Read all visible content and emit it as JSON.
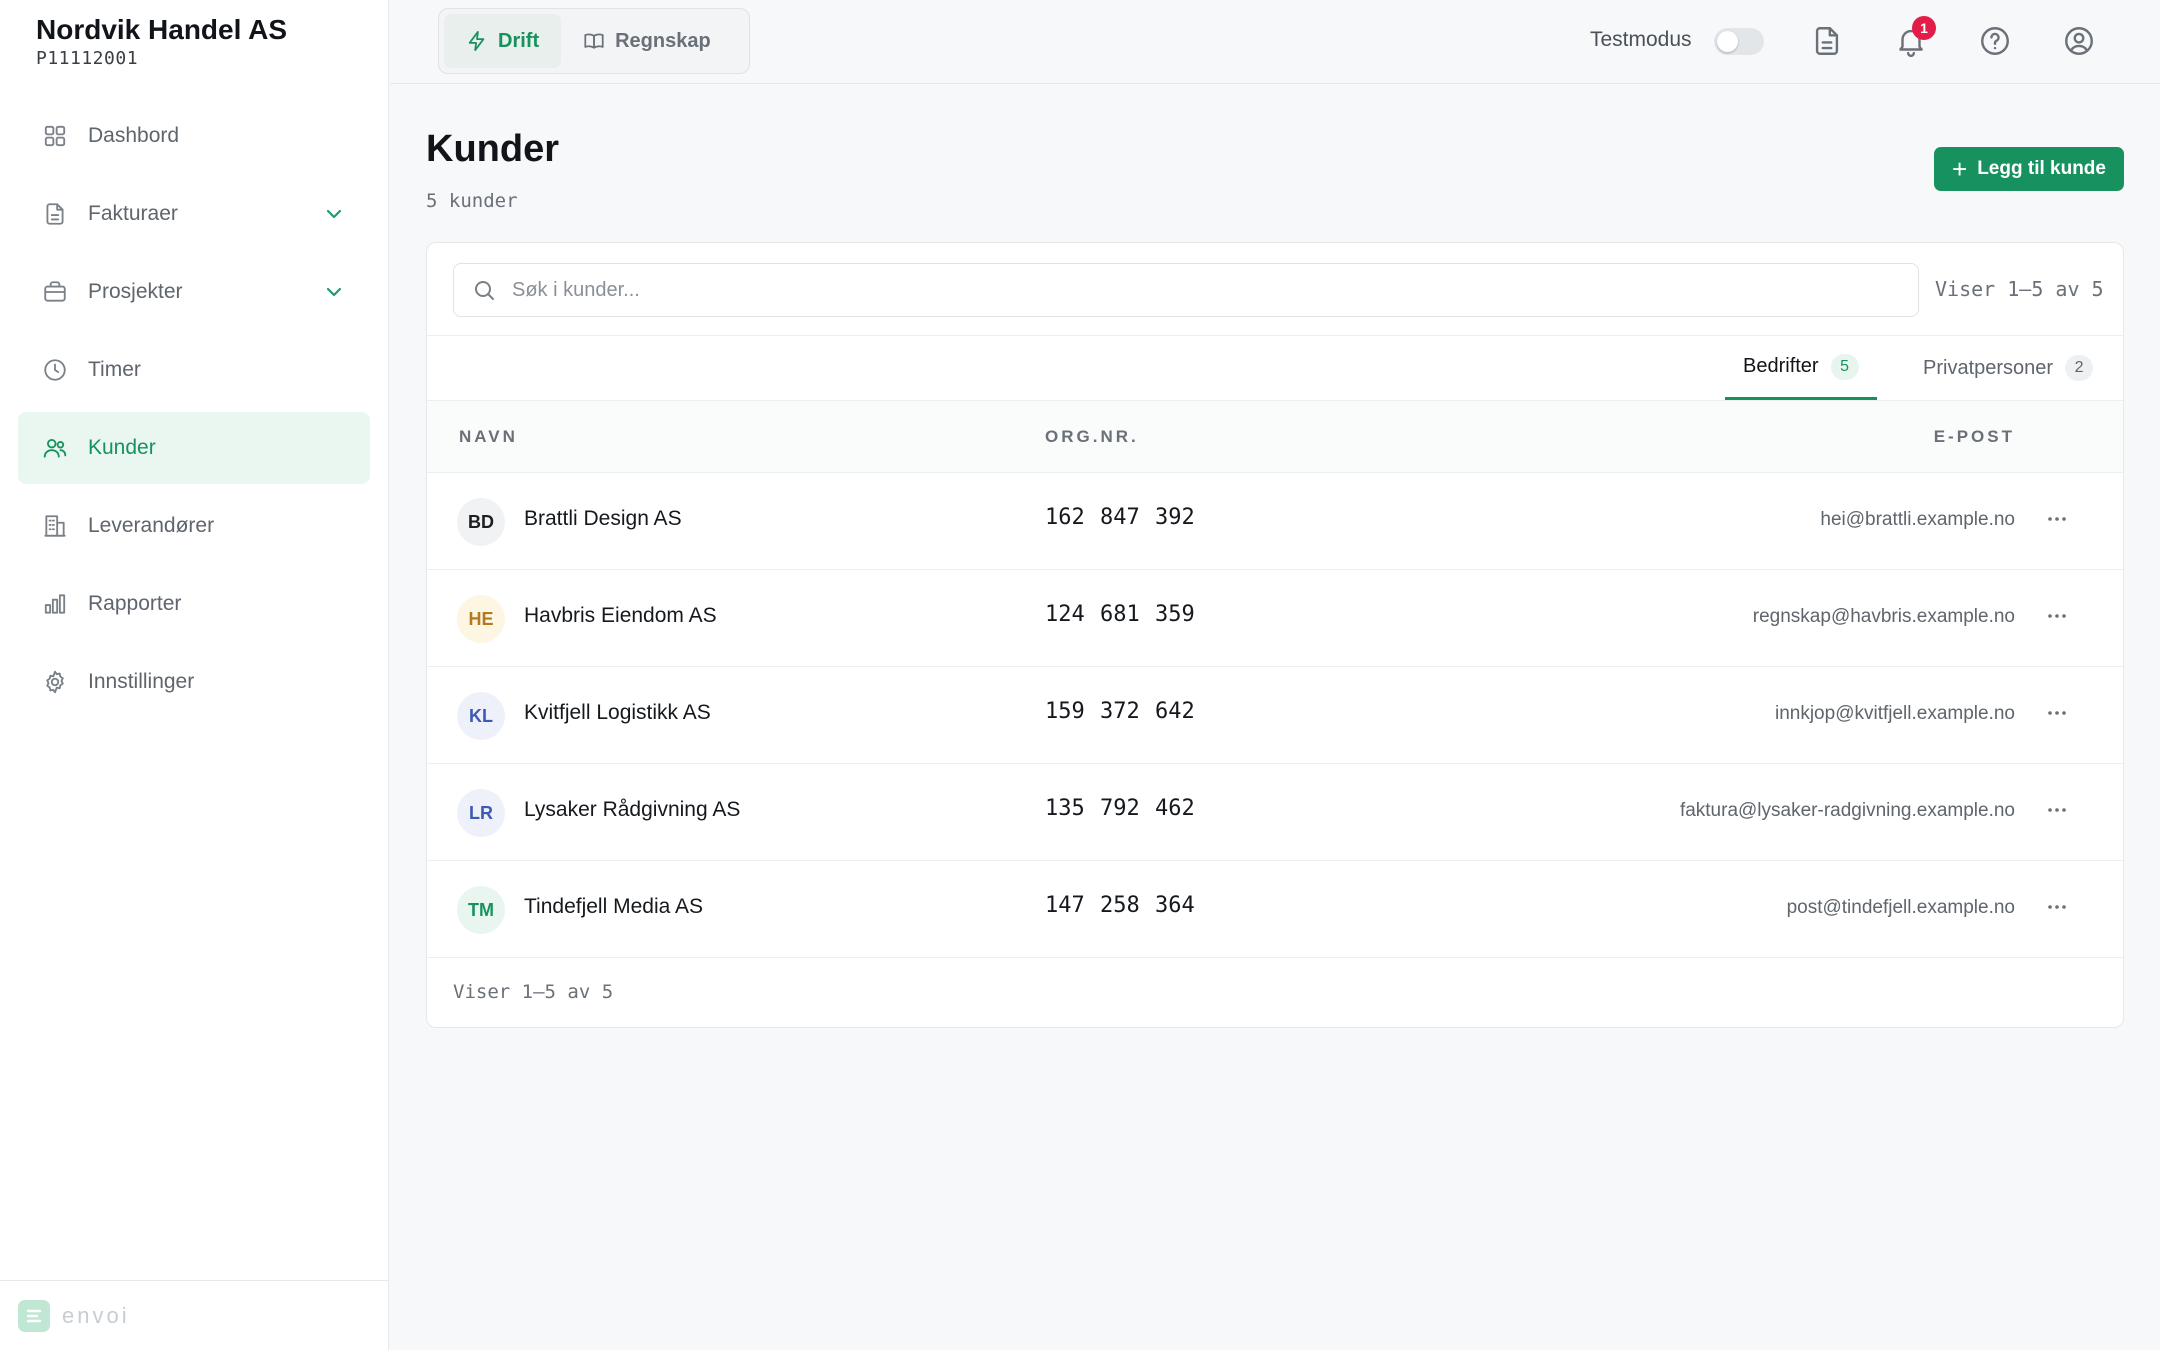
{
  "sidebar": {
    "org_name": "Nordvik Handel AS",
    "org_id": "P11112001",
    "items": [
      {
        "label": "Dashbord",
        "icon": "grid-icon"
      },
      {
        "label": "Fakturaer",
        "icon": "document-icon",
        "expandable": true
      },
      {
        "label": "Prosjekter",
        "icon": "briefcase-icon",
        "expandable": true
      },
      {
        "label": "Timer",
        "icon": "clock-icon"
      },
      {
        "label": "Kunder",
        "icon": "users-icon",
        "active": true
      },
      {
        "label": "Leverandører",
        "icon": "building-icon"
      },
      {
        "label": "Rapporter",
        "icon": "bar-chart-icon"
      },
      {
        "label": "Innstillinger",
        "icon": "gear-icon"
      }
    ],
    "brand": "envoi"
  },
  "topbar": {
    "tabs": [
      {
        "label": "Drift",
        "icon": "lightning-icon",
        "active": true
      },
      {
        "label": "Regnskap",
        "icon": "book-icon",
        "active": false
      }
    ],
    "test_mode_label": "Testmodus",
    "test_mode_on": false,
    "notification_count": "1"
  },
  "main": {
    "title": "Kunder",
    "subtitle": "5 kunder",
    "add_button_label": "Legg til kunde",
    "search_placeholder": "Søk i kunder...",
    "pagination_top": "Viser 1–5 av 5",
    "pagination_bottom": "Viser 1–5 av 5",
    "tabs": [
      {
        "label": "Bedrifter",
        "count": "5",
        "active": true
      },
      {
        "label": "Privatpersoner",
        "count": "2",
        "active": false
      }
    ],
    "columns": {
      "name": "NAVN",
      "orgnr": "ORG.NR.",
      "email": "E-POST"
    },
    "rows": [
      {
        "initials": "BD",
        "name": "Brattli Design AS",
        "orgnr": "162 847 392",
        "email": "hei@brattli.example.no",
        "avatar_bg": "#f1f2f4",
        "avatar_fg": "#1b1e23"
      },
      {
        "initials": "HE",
        "name": "Havbris Eiendom AS",
        "orgnr": "124 681 359",
        "email": "regnskap@havbris.example.no",
        "avatar_bg": "#fdf6e3",
        "avatar_fg": "#b7791f"
      },
      {
        "initials": "KL",
        "name": "Kvitfjell Logistikk AS",
        "orgnr": "159 372 642",
        "email": "innkjop@kvitfjell.example.no",
        "avatar_bg": "#eef1f9",
        "avatar_fg": "#3b5bb5"
      },
      {
        "initials": "LR",
        "name": "Lysaker Rådgivning AS",
        "orgnr": "135 792 462",
        "email": "faktura@lysaker-radgivning.example.no",
        "avatar_bg": "#eef1f9",
        "avatar_fg": "#3b5bb5"
      },
      {
        "initials": "TM",
        "name": "Tindefjell Media AS",
        "orgnr": "147 258 364",
        "email": "post@tindefjell.example.no",
        "avatar_bg": "#e9f6ef",
        "avatar_fg": "#17925f"
      }
    ]
  },
  "colors": {
    "accent": "#17925f",
    "badge": "#e11d48"
  }
}
